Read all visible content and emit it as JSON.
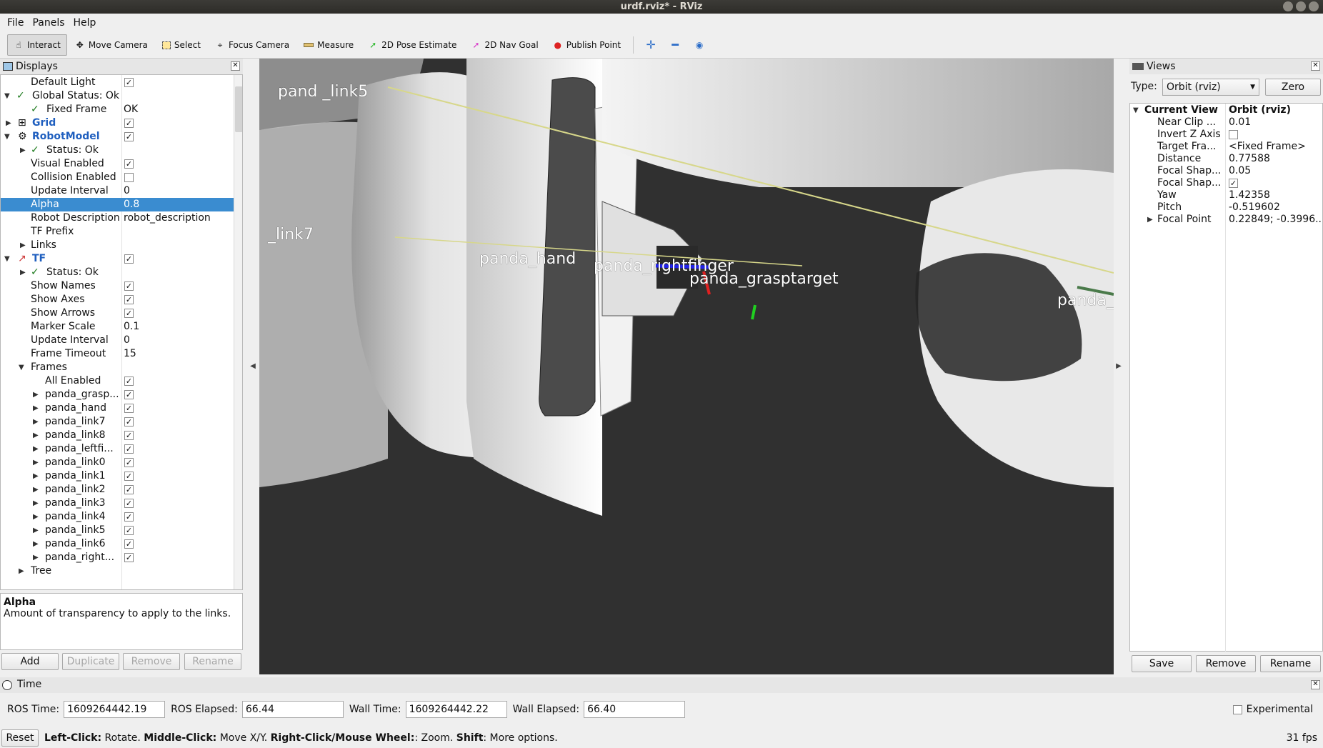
{
  "window": {
    "title": "urdf.rviz* - RViz"
  },
  "menu": [
    "File",
    "Panels",
    "Help"
  ],
  "toolbar": {
    "interact": "Interact",
    "move_camera": "Move Camera",
    "select": "Select",
    "focus_camera": "Focus Camera",
    "measure": "Measure",
    "pose_estimate": "2D Pose Estimate",
    "nav_goal": "2D Nav Goal",
    "publish_point": "Publish Point"
  },
  "displays": {
    "title": "Displays",
    "rows": [
      {
        "label": "Default Light",
        "value": "",
        "checked": true
      },
      {
        "label": "Global Status: Ok",
        "value": ""
      },
      {
        "label": "Fixed Frame",
        "value": "OK"
      },
      {
        "label": "Grid",
        "value": "",
        "checked": true
      },
      {
        "label": "RobotModel",
        "value": "",
        "checked": true
      },
      {
        "label": "Status: Ok",
        "value": ""
      },
      {
        "label": "Visual Enabled",
        "value": "",
        "checked": true
      },
      {
        "label": "Collision Enabled",
        "value": "",
        "checked": false
      },
      {
        "label": "Update Interval",
        "value": "0"
      },
      {
        "label": "Alpha",
        "value": "0.8"
      },
      {
        "label": "Robot Description",
        "value": "robot_description"
      },
      {
        "label": "TF Prefix",
        "value": ""
      },
      {
        "label": "Links",
        "value": ""
      },
      {
        "label": "TF",
        "value": "",
        "checked": true
      },
      {
        "label": "Status: Ok",
        "value": ""
      },
      {
        "label": "Show Names",
        "value": "",
        "checked": true
      },
      {
        "label": "Show Axes",
        "value": "",
        "checked": true
      },
      {
        "label": "Show Arrows",
        "value": "",
        "checked": true
      },
      {
        "label": "Marker Scale",
        "value": "0.1"
      },
      {
        "label": "Update Interval",
        "value": "0"
      },
      {
        "label": "Frame Timeout",
        "value": "15"
      },
      {
        "label": "Frames",
        "value": ""
      },
      {
        "label": "All Enabled",
        "value": "",
        "checked": true
      },
      {
        "label": "panda_grasp...",
        "value": "",
        "checked": true
      },
      {
        "label": "panda_hand",
        "value": "",
        "checked": true
      },
      {
        "label": "panda_link7",
        "value": "",
        "checked": true
      },
      {
        "label": "panda_link8",
        "value": "",
        "checked": true
      },
      {
        "label": "panda_leftfi...",
        "value": "",
        "checked": true
      },
      {
        "label": "panda_link0",
        "value": "",
        "checked": true
      },
      {
        "label": "panda_link1",
        "value": "",
        "checked": true
      },
      {
        "label": "panda_link2",
        "value": "",
        "checked": true
      },
      {
        "label": "panda_link3",
        "value": "",
        "checked": true
      },
      {
        "label": "panda_link4",
        "value": "",
        "checked": true
      },
      {
        "label": "panda_link5",
        "value": "",
        "checked": true
      },
      {
        "label": "panda_link6",
        "value": "",
        "checked": true
      },
      {
        "label": "panda_right...",
        "value": "",
        "checked": true
      },
      {
        "label": "Tree",
        "value": ""
      }
    ],
    "desc_title": "Alpha",
    "desc_text": "Amount of transparency to apply to the links.",
    "buttons": {
      "add": "Add",
      "duplicate": "Duplicate",
      "remove": "Remove",
      "rename": "Rename"
    }
  },
  "viewport_labels": {
    "link5": "pand _link5",
    "link7": "_link7",
    "hand": "panda_hand",
    "finger": "panda_rightfinger",
    "grasp": "panda_grasptarget",
    "right": "panda_li"
  },
  "views": {
    "title": "Views",
    "type_label": "Type:",
    "type_value": "Orbit (rviz)",
    "zero": "Zero",
    "rows": [
      {
        "label": "Current View",
        "value": "Orbit (rviz)"
      },
      {
        "label": "Near Clip ...",
        "value": "0.01"
      },
      {
        "label": "Invert Z Axis",
        "value": ""
      },
      {
        "label": "Target Fra...",
        "value": "<Fixed Frame>"
      },
      {
        "label": "Distance",
        "value": "0.77588"
      },
      {
        "label": "Focal Shap...",
        "value": "0.05"
      },
      {
        "label": "Focal Shap...",
        "value": ""
      },
      {
        "label": "Yaw",
        "value": "1.42358"
      },
      {
        "label": "Pitch",
        "value": "-0.519602"
      },
      {
        "label": "Focal Point",
        "value": "0.22849; -0.3996..."
      }
    ],
    "buttons": {
      "save": "Save",
      "remove": "Remove",
      "rename": "Rename"
    }
  },
  "time": {
    "title": "Time",
    "ros_time_label": "ROS Time:",
    "ros_time": "1609264442.19",
    "ros_elapsed_label": "ROS Elapsed:",
    "ros_elapsed": "66.44",
    "wall_time_label": "Wall Time:",
    "wall_time": "1609264442.22",
    "wall_elapsed_label": "Wall Elapsed:",
    "wall_elapsed": "66.40",
    "experimental": "Experimental"
  },
  "status": {
    "reset": "Reset",
    "lc": "Left-Click:",
    "lc_t": " Rotate. ",
    "mc": "Middle-Click:",
    "mc_t": " Move X/Y. ",
    "rc": "Right-Click/Mouse Wheel:",
    "rc_t": ": Zoom. ",
    "sh": "Shift",
    "sh_t": ": More options.",
    "fps": "31 fps"
  }
}
